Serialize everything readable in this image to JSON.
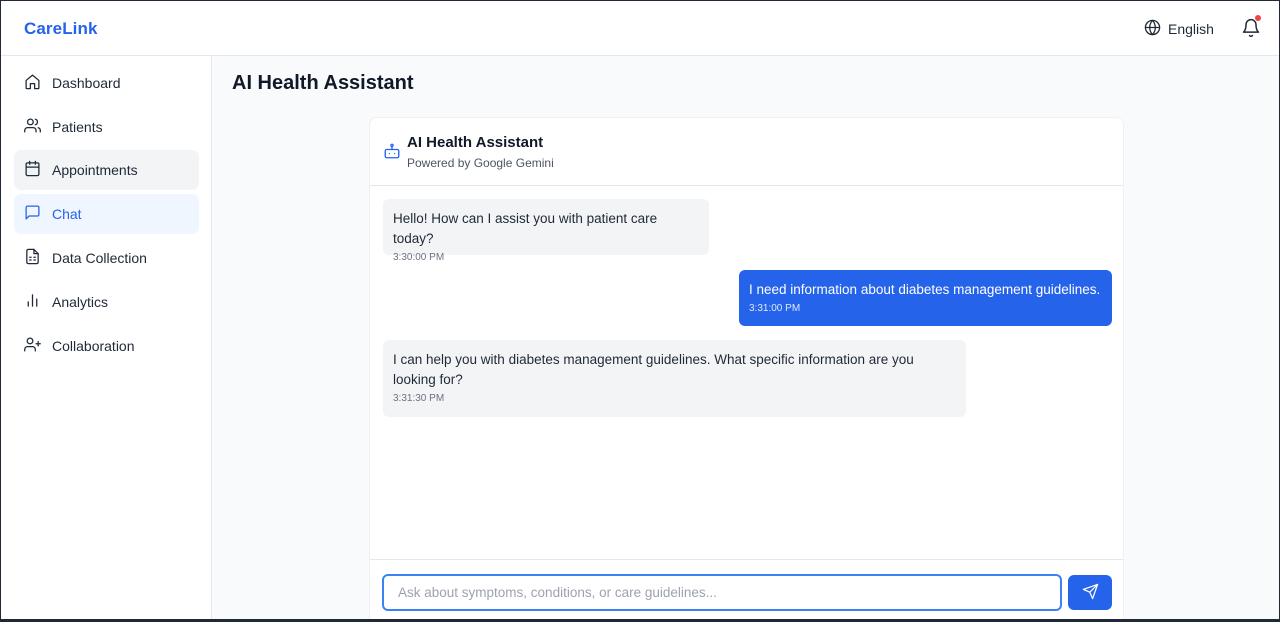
{
  "header": {
    "brand": "CareLink",
    "language": "English",
    "notification_dot": true
  },
  "sidebar": {
    "items": [
      {
        "label": "Dashboard",
        "icon": "home-icon",
        "state": "default"
      },
      {
        "label": "Patients",
        "icon": "users-icon",
        "state": "default"
      },
      {
        "label": "Appointments",
        "icon": "calendar-icon",
        "state": "hover"
      },
      {
        "label": "Chat",
        "icon": "message-icon",
        "state": "active"
      },
      {
        "label": "Data Collection",
        "icon": "clipboard-icon",
        "state": "default"
      },
      {
        "label": "Analytics",
        "icon": "bar-chart-icon",
        "state": "default"
      },
      {
        "label": "Collaboration",
        "icon": "user-plus-icon",
        "state": "default"
      }
    ]
  },
  "main": {
    "title": "AI Health Assistant"
  },
  "chat": {
    "title": "AI Health Assistant",
    "subtitle": "Powered by Google Gemini",
    "messages": [
      {
        "role": "assistant",
        "text": "Hello! How can I assist you with patient care today?",
        "time": "3:30:00 PM"
      },
      {
        "role": "user",
        "text": "I need information about diabetes management guidelines.",
        "time": "3:31:00 PM"
      },
      {
        "role": "assistant",
        "text": "I can help you with diabetes management guidelines. What specific information are you looking for?",
        "time": "3:31:30 PM"
      }
    ],
    "input": {
      "value": "",
      "placeholder": "Ask about symptoms, conditions, or care guidelines..."
    }
  },
  "colors": {
    "accent": "#2563eb",
    "active_bg": "#eff6ff",
    "bubble_bot": "#f3f4f6",
    "notification": "#ef4444"
  }
}
